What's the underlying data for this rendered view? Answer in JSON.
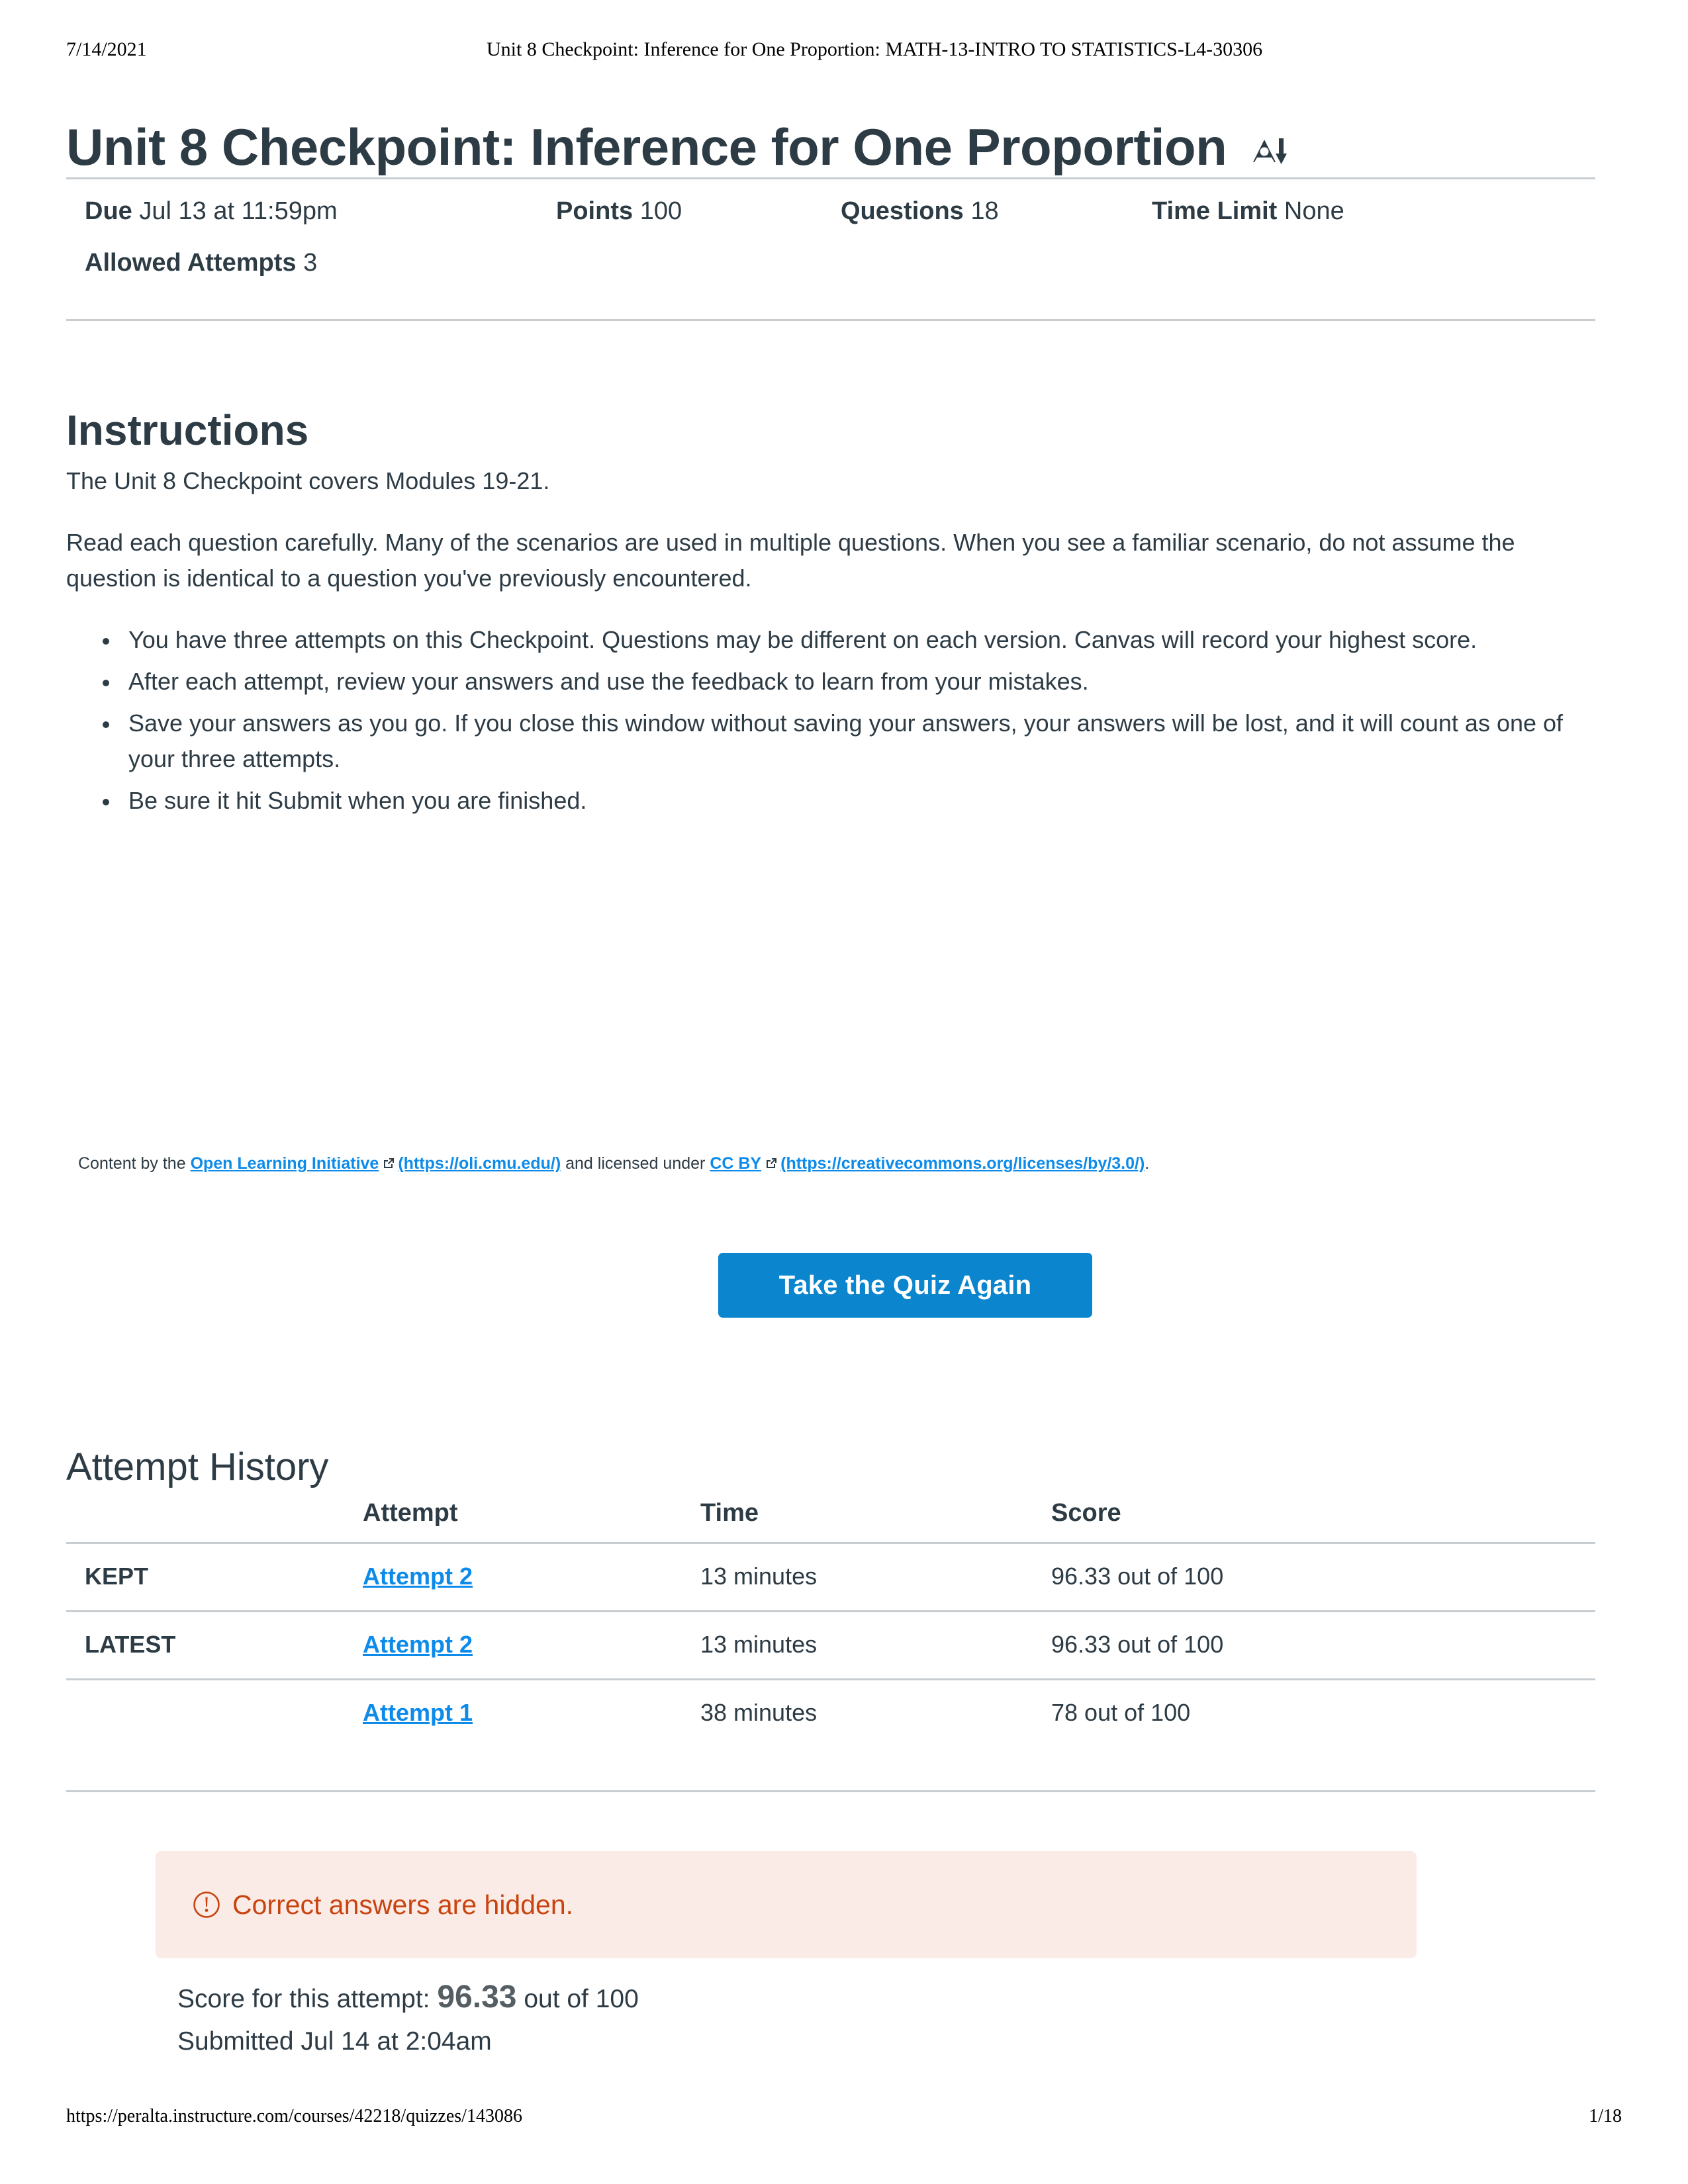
{
  "print_header": {
    "date": "7/14/2021",
    "title": "Unit 8 Checkpoint: Inference for One Proportion: MATH-13-INTRO TO STATISTICS-L4-30306"
  },
  "quiz": {
    "title": "Unit 8 Checkpoint: Inference for One Proportion",
    "accessibility_icon": "accessibility-person-down-icon"
  },
  "meta": {
    "due_label": "Due",
    "due_value": "Jul 13 at 11:59pm",
    "points_label": "Points",
    "points_value": "100",
    "questions_label": "Questions",
    "questions_value": "18",
    "time_limit_label": "Time Limit",
    "time_limit_value": "None",
    "allowed_attempts_label": "Allowed Attempts",
    "allowed_attempts_value": "3"
  },
  "instructions": {
    "heading": "Instructions",
    "paragraphs": [
      "The Unit 8 Checkpoint covers Modules 19-21.",
      "Read each question carefully. Many of the scenarios are used in multiple questions. When you see a familiar scenario, do not assume the question is identical to a question you've previously encountered."
    ],
    "bullets": [
      "You have three attempts on this Checkpoint. Questions may be different on each version. Canvas will record your highest score.",
      "After each attempt, review your answers and use the feedback to learn from your mistakes.",
      "Save your answers as you go. If you close this window without saving your answers, your answers will be lost, and it will count as one of your three attempts.",
      "Be sure it hit Submit when you are finished."
    ]
  },
  "attribution": {
    "prefix": "Content by the ",
    "link1_text": "Open Learning Initiative",
    "link1_url_text": "(https://oli.cmu.edu/)",
    "middle": " and licensed under ",
    "link2_text": "CC BY",
    "link2_url_text": "(https://creativecommons.org/licenses/by/3.0/)",
    "suffix": ".",
    "external_icon": "external-link-icon"
  },
  "actions": {
    "take_quiz_again": "Take the Quiz Again",
    "button_color": "#0a85ce"
  },
  "attempt_history": {
    "heading": "Attempt History",
    "columns": [
      "",
      "Attempt",
      "Time",
      "Score"
    ],
    "rows": [
      {
        "tag": "KEPT",
        "attempt": "Attempt 2",
        "time": "13 minutes",
        "score": "96.33 out of 100"
      },
      {
        "tag": "LATEST",
        "attempt": "Attempt 2",
        "time": "13 minutes",
        "score": "96.33 out of 100"
      },
      {
        "tag": "",
        "attempt": "Attempt 1",
        "time": "38 minutes",
        "score": "78 out of 100"
      }
    ]
  },
  "alert": {
    "icon": "warning-circle-icon",
    "text": "Correct answers are hidden.",
    "bg_color": "#fbebe6",
    "text_color": "#c8430e"
  },
  "result": {
    "score_prefix": "Score for this attempt:",
    "score_value": "96.33",
    "score_suffix": "out of 100",
    "submitted": "Submitted Jul 14 at 2:04am"
  },
  "print_footer": {
    "url": "https://peralta.instructure.com/courses/42218/quizzes/143086",
    "page": "1/18"
  }
}
